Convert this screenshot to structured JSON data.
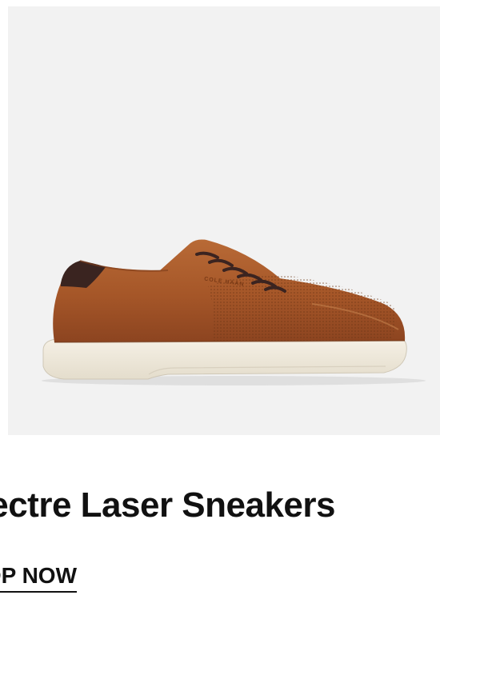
{
  "product": {
    "image_alt": "Brown leather perforated low-top sneaker with white sole",
    "title": "Grand Spectre Laser Sneakers",
    "cta_label": "SHOP NOW",
    "brand_mark": "COLE HAAN"
  },
  "colors": {
    "image_background": "#f2f2f2",
    "leather": "#a85a2c",
    "heel_tab": "#3a2420",
    "laces": "#3b2420",
    "sole": "#f1ece1",
    "text": "#111111"
  }
}
